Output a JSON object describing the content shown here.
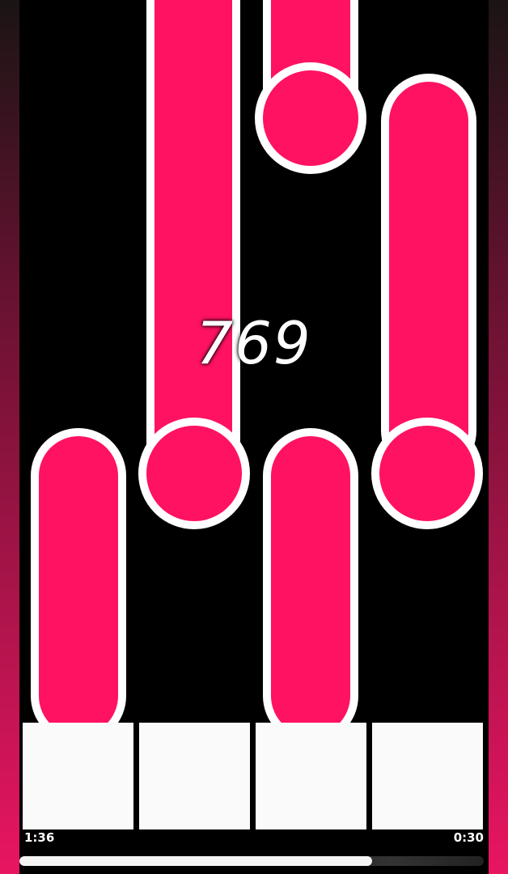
{
  "score": "769",
  "time_elapsed": "1:36",
  "time_remaining": "0:30",
  "progress": 0.76,
  "colors": {
    "note": "#ff1262",
    "note_outline": "#ffffff",
    "key": "#fafafa",
    "background": "#000000",
    "side_gradient_top": "#1a1414",
    "side_gradient_bottom": "#e81560"
  },
  "lanes": 4,
  "keys": [
    {
      "lane": 1
    },
    {
      "lane": 2
    },
    {
      "lane": 3
    },
    {
      "lane": 4
    }
  ]
}
